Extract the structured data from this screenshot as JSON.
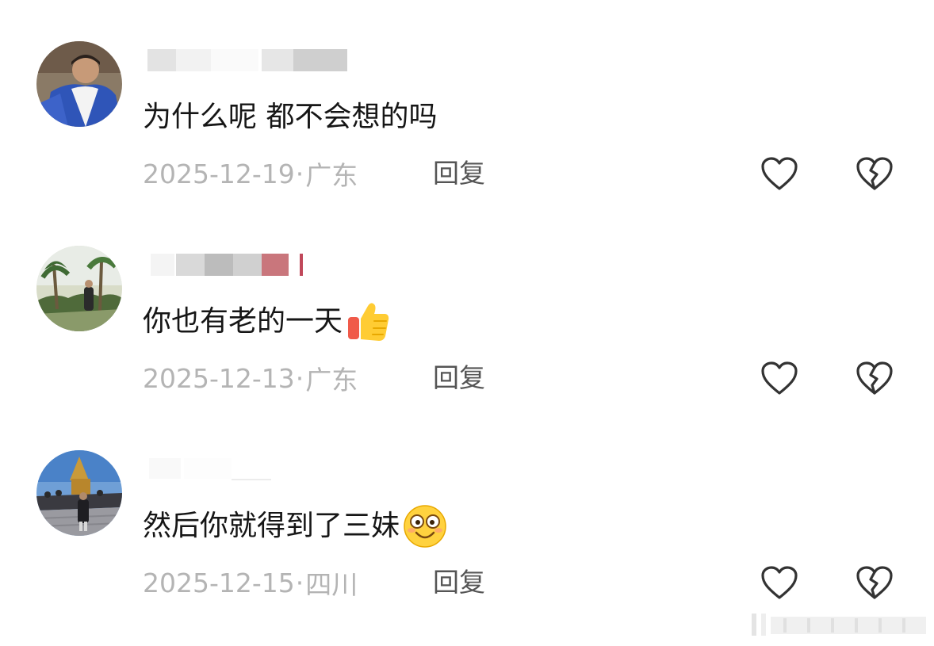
{
  "comments": [
    {
      "text": "为什么呢 都不会想的吗",
      "date": "2025-12-19",
      "separator": "·",
      "location": "广东",
      "reply_label": "回复",
      "emoji": "",
      "avatar_icon": "avatar-man-blue-jacket"
    },
    {
      "text": "你也有老的一天",
      "date": "2025-12-13",
      "separator": "·",
      "location": "广东",
      "reply_label": "回复",
      "emoji": "thumbs-up-icon",
      "avatar_icon": "avatar-man-palm-trees"
    },
    {
      "text": "然后你就得到了三妹",
      "date": "2025-12-15",
      "separator": "·",
      "location": "四川",
      "reply_label": "回复",
      "emoji": "smiley-icon",
      "avatar_icon": "avatar-man-temple"
    }
  ],
  "icons": {
    "like": "heart-outline-icon",
    "dislike": "broken-heart-outline-icon"
  },
  "colors": {
    "text": "#161616",
    "meta": "#b4b4b4",
    "reply": "#555555",
    "icon": "#333333"
  }
}
